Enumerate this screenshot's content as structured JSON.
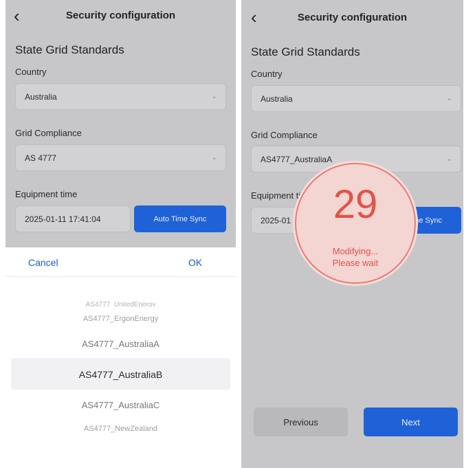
{
  "screen_title": "Security configuration",
  "section_title": "State Grid Standards",
  "country": {
    "label": "Country",
    "value": "Australia"
  },
  "grid_compliance": {
    "label": "Grid Compliance",
    "value_left": "AS 4777",
    "value_right": "AS4777_AustraliaA"
  },
  "equipment_time": {
    "label_left": "Equipment time",
    "label_right_visible": "Equipment ti",
    "value_left": "2025-01-11 17:41:04",
    "value_right_visible": "2025-01"
  },
  "auto_sync": {
    "label_left": "Auto Time Sync",
    "label_right_visible": "ne Sync"
  },
  "picker": {
    "cancel": "Cancel",
    "ok": "OK",
    "options": [
      "AS4777_UnitedEnergy",
      "AS4777_ErgonEnergy",
      "AS4777_AustraliaA",
      "AS4777_AustraliaB",
      "AS4777_AustraliaC",
      "AS4777_NewZealand"
    ],
    "selected": "AS4777_AustraliaB"
  },
  "countdown": {
    "number": "29",
    "line1": "Modifying...",
    "line2": "Please wait"
  },
  "nav": {
    "previous": "Previous",
    "next": "Next"
  },
  "icons": {
    "back": "back-chevron-icon",
    "dropdown": "chevron-down-icon"
  },
  "colors": {
    "accent_blue": "#1f62d8",
    "countdown_red": "#e25348",
    "overlay_gray": "#c7c7c9"
  }
}
